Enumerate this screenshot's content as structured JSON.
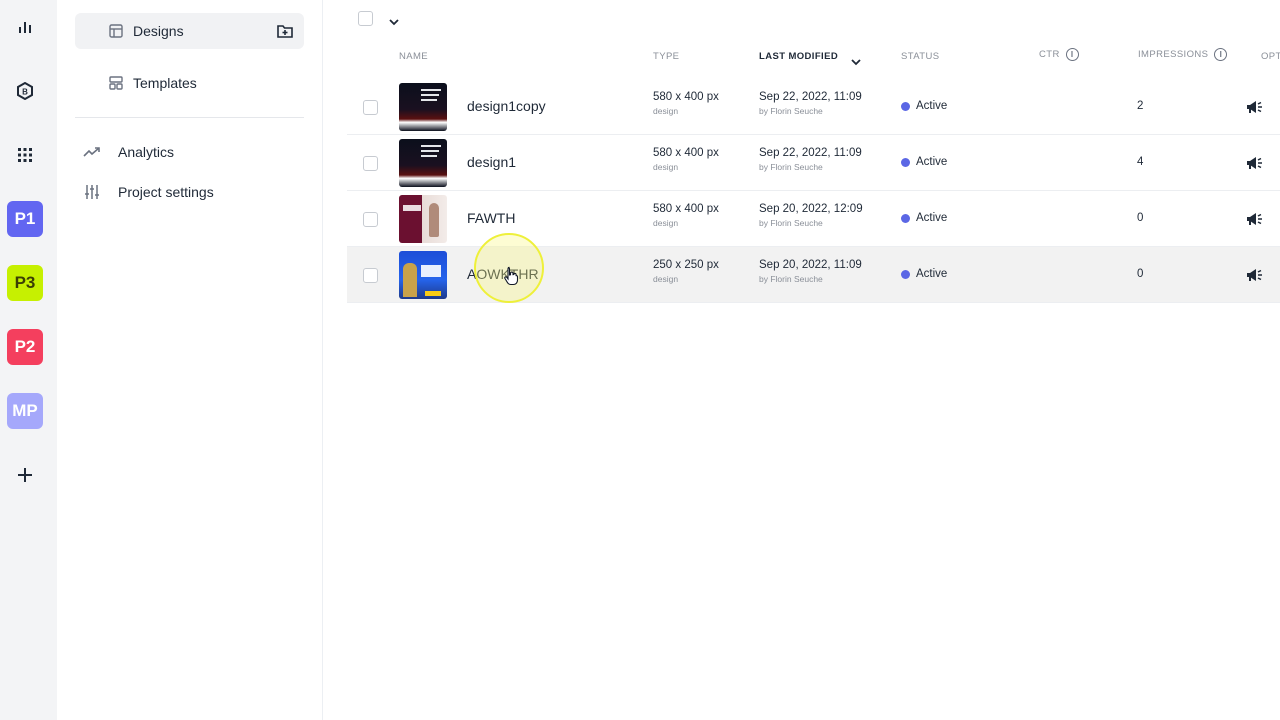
{
  "rail": {
    "projects": [
      {
        "label": "P1",
        "color": "#6266f1"
      },
      {
        "label": "P3",
        "color": "#c6f001"
      },
      {
        "label": "P2",
        "color": "#f43f5e"
      },
      {
        "label": "MP",
        "color": "#a5a8fb"
      }
    ],
    "icons": [
      "bar-chart-icon",
      "hexagon-b-icon",
      "grid-icon",
      "plus-icon"
    ]
  },
  "sidebar": {
    "designs_label": "Designs",
    "templates_label": "Templates",
    "analytics_label": "Analytics",
    "settings_label": "Project settings"
  },
  "table": {
    "headers": {
      "name": "NAME",
      "type": "TYPE",
      "modified": "LAST MODIFIED",
      "status": "STATUS",
      "ctr": "CTR",
      "impressions": "IMPRESSIONS",
      "options": "OPT"
    },
    "rows": [
      {
        "name": "design1copy",
        "size": "580 x 400 px",
        "kind": "design",
        "date": "Sep 22, 2022, 11:09",
        "by": "by Florin Seuche",
        "status": "Active",
        "impressions": "2"
      },
      {
        "name": "design1",
        "size": "580 x 400 px",
        "kind": "design",
        "date": "Sep 22, 2022, 11:09",
        "by": "by Florin Seuche",
        "status": "Active",
        "impressions": "4"
      },
      {
        "name": "FAWTH",
        "size": "580 x 400 px",
        "kind": "design",
        "date": "Sep 20, 2022, 12:09",
        "by": "by Florin Seuche",
        "status": "Active",
        "impressions": "0"
      },
      {
        "name": "AOWKTHR",
        "size": "250 x 250 px",
        "kind": "design",
        "date": "Sep 20, 2022, 11:09",
        "by": "by Florin Seuche",
        "status": "Active",
        "impressions": "0"
      }
    ]
  },
  "colors": {
    "active_dot": "#5b67e5",
    "hover_row": "#f2f2f2"
  }
}
